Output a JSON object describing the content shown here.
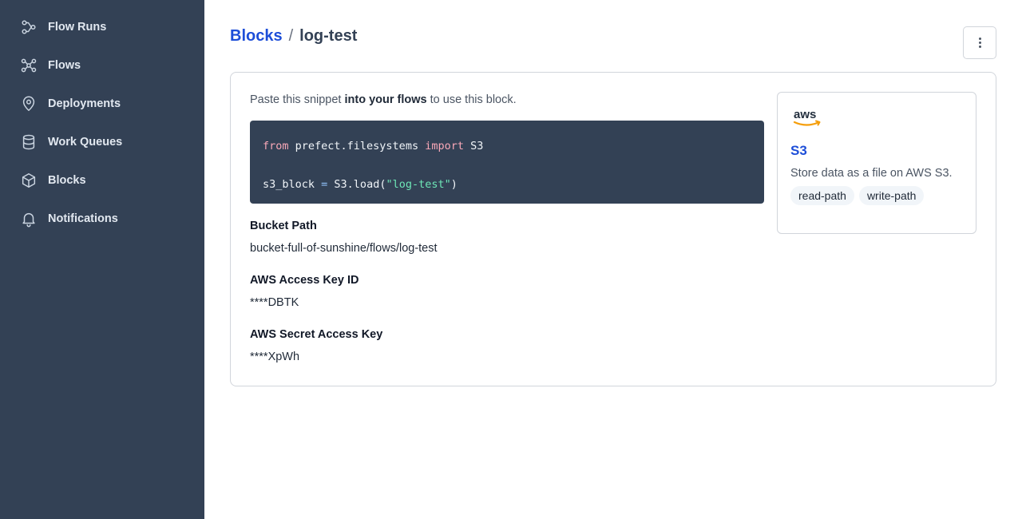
{
  "sidebar": {
    "items": [
      {
        "label": "Flow Runs",
        "icon": "flow-runs-icon"
      },
      {
        "label": "Flows",
        "icon": "flows-icon"
      },
      {
        "label": "Deployments",
        "icon": "map-pin-icon"
      },
      {
        "label": "Work Queues",
        "icon": "database-icon"
      },
      {
        "label": "Blocks",
        "icon": "cube-icon"
      },
      {
        "label": "Notifications",
        "icon": "bell-icon"
      }
    ]
  },
  "breadcrumb": {
    "parent": "Blocks",
    "separator": "/",
    "current": "log-test"
  },
  "snippet": {
    "hint_prefix": "Paste this snippet ",
    "hint_bold": "into your flows",
    "hint_suffix": " to use this block.",
    "line1": {
      "kw1": "from",
      "module": " prefect.filesystems ",
      "kw2": "import",
      "name": " S3"
    },
    "line2": {
      "var": "s3_block ",
      "op": "=",
      "call": " S3.load(",
      "arg": "\"log-test\"",
      "close": ")"
    }
  },
  "fields": [
    {
      "label": "Bucket Path",
      "value": "bucket-full-of-sunshine/flows/log-test"
    },
    {
      "label": "AWS Access Key ID",
      "value": "****DBTK"
    },
    {
      "label": "AWS Secret Access Key",
      "value": "****XpWh"
    }
  ],
  "block_type": {
    "logo": "aws-logo",
    "logo_text": "aws",
    "name": "S3",
    "description": "Store data as a file on AWS S3.",
    "capabilities": [
      "read-path",
      "write-path"
    ]
  },
  "colors": {
    "sidebar_bg": "#334155",
    "accent": "#1d4ed8",
    "code_bg": "#334155"
  }
}
